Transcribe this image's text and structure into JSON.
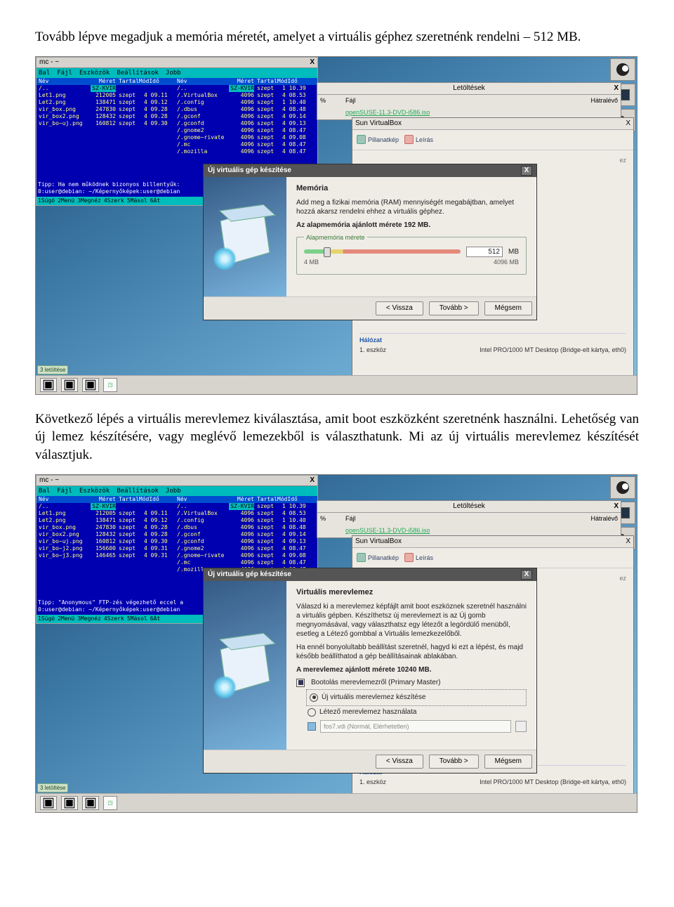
{
  "para1": "Tovább lépve megadjuk a memória méretét, amelyet a virtuális géphez szeretnénk rendelni – 512 MB.",
  "para2": "Következő lépés a virtuális merevlemez kiválasztása, amit boot eszközként szeretnénk használni. Lehetőség van új lemez készítésére, vagy meglévő lemezekből is választhatunk. Mi az új virtuális merevlemez készítését választjuk.",
  "mc": {
    "title": "mc - ~",
    "close": "X",
    "menu": [
      "Bal",
      "Fájl",
      "Eszközök",
      "Beállítások",
      "Jobb"
    ],
    "path_left": "~/Képernyőképek",
    "path_right": "~",
    "head": [
      "Név",
      "Méret",
      "TartalMódIdő"
    ],
    "selA": "SZ-KVIR",
    "selB": "SZ-KVIR",
    "rowsA": [
      [
        "Let1.png",
        "212005",
        "szept",
        "4 09.11"
      ],
      [
        "Let2.png",
        "138471",
        "szept",
        "4 09.12"
      ],
      [
        "vir_box.png",
        "247830",
        "szept",
        "4 09.28"
      ],
      [
        "vir_box2.png",
        "128432",
        "szept",
        "4 09.28"
      ],
      [
        "vir_bo~uj.png",
        "160812",
        "szept",
        "4 09.30"
      ]
    ],
    "rowsA2": [
      [
        "Let1.png",
        "212005",
        "szept",
        "4 09.11"
      ],
      [
        "Let2.png",
        "138471",
        "szept",
        "4 09.12"
      ],
      [
        "vir_box.png",
        "247830",
        "szept",
        "4 09.28"
      ],
      [
        "vir_box2.png",
        "128432",
        "szept",
        "4 09.28"
      ],
      [
        "vir_bo~uj.png",
        "160812",
        "szept",
        "4 09.30"
      ],
      [
        "vir_bo~j2.png",
        "156600",
        "szept",
        "4 09.31"
      ],
      [
        "vir_bo~j3.png",
        "146465",
        "szept",
        "4 09.31"
      ]
    ],
    "rowsB": [
      [
        "/..",
        "",
        "szept",
        "1 10.39"
      ],
      [
        "/.VirtualBox",
        "4096",
        "szept",
        "4 08.53"
      ],
      [
        "/.config",
        "4096",
        "szept",
        "1 10.40"
      ],
      [
        "/.dbus",
        "4096",
        "szept",
        "4 08.48"
      ],
      [
        "/.gconf",
        "4096",
        "szept",
        "4 09.14"
      ],
      [
        "/.gconfd",
        "4096",
        "szept",
        "4 09.13"
      ],
      [
        "/.gnome2",
        "4096",
        "szept",
        "4 08.47"
      ],
      [
        "/.gnome~rivate",
        "4096",
        "szept",
        "4 09.08"
      ],
      [
        "/.mc",
        "4096",
        "szept",
        "4 08.47"
      ],
      [
        "/.mozilla",
        "4096",
        "szept",
        "4 08.47"
      ]
    ],
    "tip1": "Tipp: Ha nem működnek bizonyos billentyűk:",
    "tip1b": "0:user@debian: ~/Képernyőképek:user@debian",
    "tip2": "Tipp: \"Anonymous\" FTP-zés végezhető eccel a",
    "tip2b": "0:user@debian: ~/Képernyőképek:user@debian",
    "fnbar": [
      "1Súgó",
      "2Menü",
      "3Megnéz",
      "4Szerk",
      "5Másol",
      "6Át"
    ]
  },
  "downloads": {
    "title": "Letöltések",
    "close": "X",
    "col_pc": "%",
    "col_file": "Fájl",
    "col_rem": "Hátralévő",
    "file": "openSUSE-11.3-DVD-i586.iso"
  },
  "vb": {
    "title": "Sun VirtualBox",
    "close": "X",
    "tool_snap": "Pillanatkép",
    "tool_desc": "Leírás",
    "net_head": "Hálózat",
    "net_label": "1. eszköz",
    "net_value": "Intel PRO/1000 MT Desktop (Bridge-elt kártya, eth0)"
  },
  "wiz1": {
    "title": "Új virtuális gép készítése",
    "close": "X",
    "heading": "Memória",
    "p1": "Add meg a fizikai memória (RAM) mennyiségét megabájtban, amelyet hozzá akarsz rendelni ehhez a virtuális géphez.",
    "p2": "Az alapmemória ajánlott mérete 192 MB.",
    "legend": "Alapmemória mérete",
    "value": "512",
    "unit": "MB",
    "min": "4 MB",
    "max": "4096 MB",
    "btn_back": "< Vissza",
    "btn_next": "Tovább >",
    "btn_cancel": "Mégsem"
  },
  "wiz2": {
    "title": "Új virtuális gép készítése",
    "close": "X",
    "heading": "Virtuális merevlemez",
    "p1": "Válaszd ki a merevlemez képfájlt amit boot eszköznek szeretnél használni a virtuális gépben. Készíthetsz új merevlemezt is az Új gomb megnyomásával, vagy választhatsz egy létezőt a legördülő menüből, esetleg a Létező gombbal a Virtuális lemezkezelőből.",
    "p2": "Ha ennél bonyolultabb beállítást szeretnél, hagyd ki ezt a lépést, és majd később beállíthatod a gép beállításainak ablakában.",
    "p3": "A merevlemez ajánlott mérete 10240 MB.",
    "chk_label": "Bootolás merevlemezről (Primary Master)",
    "opt_new": "Új virtuális merevlemez készítése",
    "opt_exist": "Létező merevlemez használata",
    "combo": "fos7.vdi (Normál, Elérhetetlen)",
    "btn_back": "< Vissza",
    "btn_next": "Tovább >",
    "btn_cancel": "Mégsem"
  },
  "status": "3 letöltése",
  "ez_label": "ez"
}
